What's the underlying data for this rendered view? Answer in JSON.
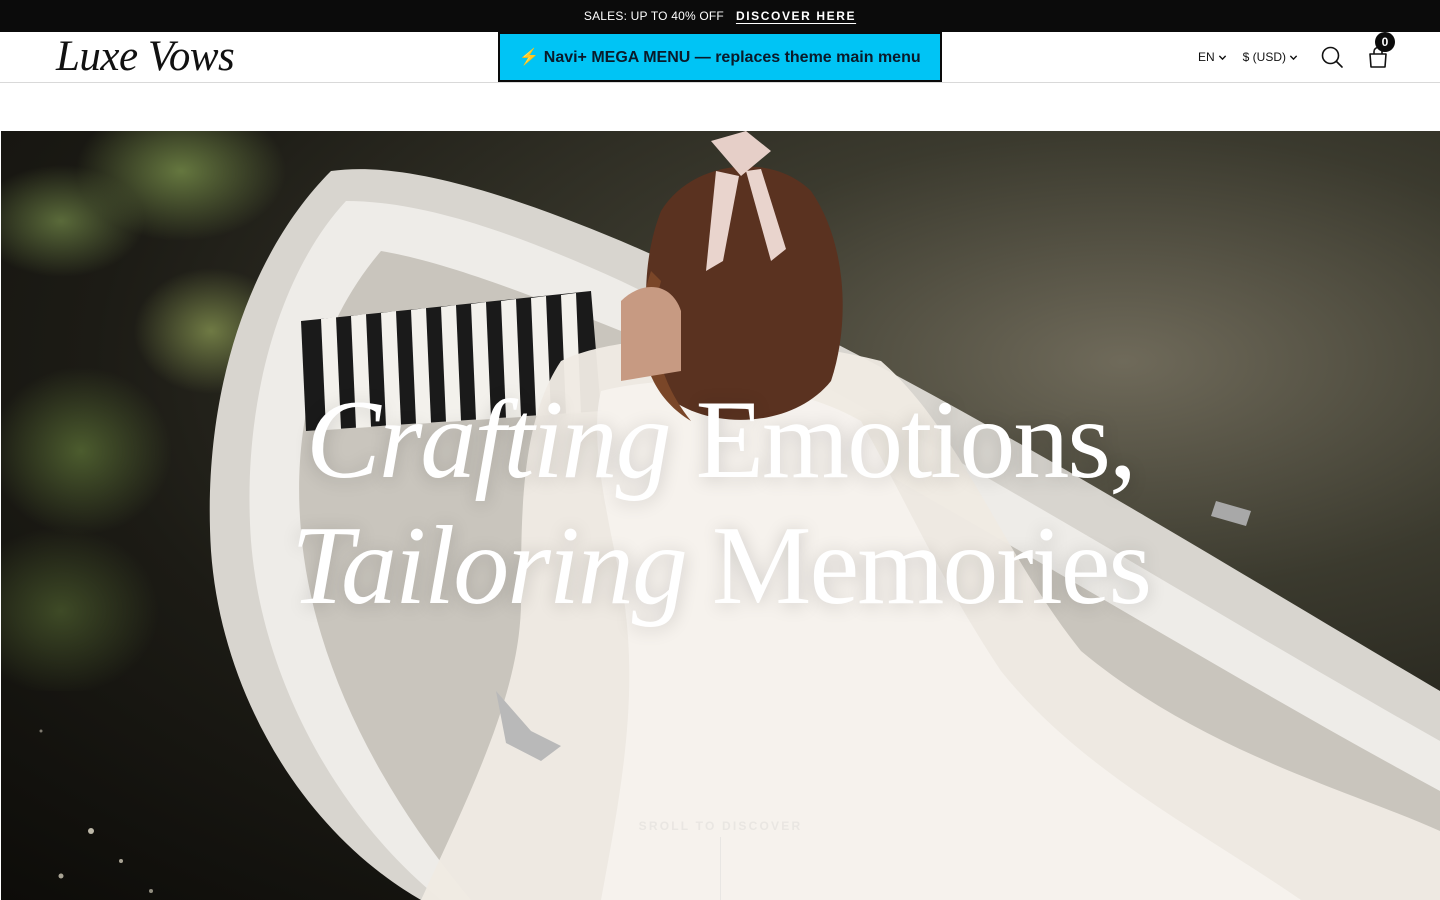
{
  "announcement": {
    "promo_text": "SALES: UP TO 40% OFF",
    "link_text": "DISCOVER HERE"
  },
  "header": {
    "logo_text": "Luxe Vows",
    "mega_menu_label": "⚡ Navi+ MEGA MENU — replaces theme main menu",
    "language": "EN",
    "currency": "$ (USD)",
    "cart_count": "0",
    "icons": [
      "chevron-down-icon",
      "search-icon",
      "bag-icon"
    ]
  },
  "hero": {
    "line1_italic": "Crafting",
    "line1_regular": "Emotions,",
    "line2_italic": "Tailoring",
    "line2_regular": "Memories",
    "scroll_text": "SROLL TO DISCOVER"
  },
  "colors": {
    "announcement_bg": "#0b0b0b",
    "mega_menu_bg": "#00c4f5",
    "text": "#111111"
  }
}
